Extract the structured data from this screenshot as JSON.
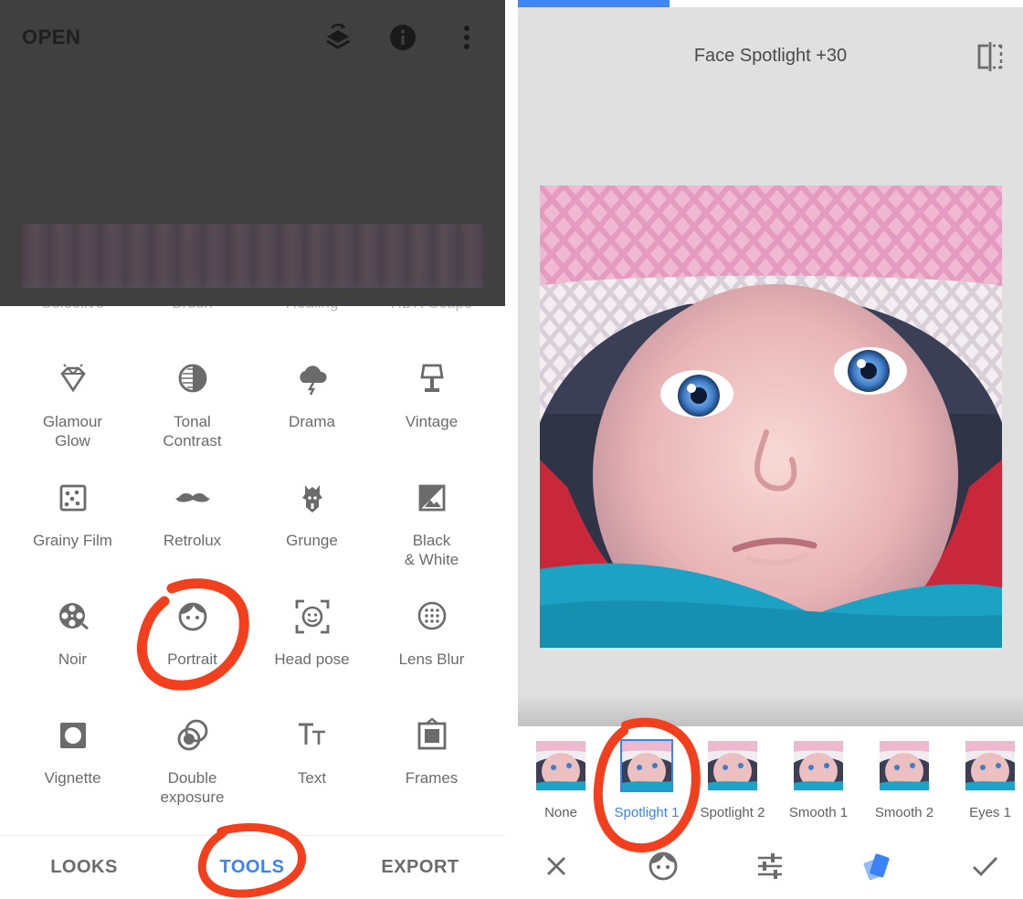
{
  "left_screen": {
    "top_bar": {
      "open_label": "OPEN",
      "icons": [
        "layers-stack-icon",
        "info-icon",
        "more-vert-icon"
      ]
    },
    "cut_off_row": [
      "Selective",
      "Brush",
      "Healing",
      "HDR Scape"
    ],
    "tools": [
      {
        "label": "Glamour\nGlow",
        "icon": "diamond-icon"
      },
      {
        "label": "Tonal\nContrast",
        "icon": "contrast-circle-icon"
      },
      {
        "label": "Drama",
        "icon": "storm-cloud-icon"
      },
      {
        "label": "Vintage",
        "icon": "lamp-icon"
      },
      {
        "label": "Grainy Film",
        "icon": "grain-icon"
      },
      {
        "label": "Retrolux",
        "icon": "mustache-icon"
      },
      {
        "label": "Grunge",
        "icon": "grunge-guitar-icon"
      },
      {
        "label": "Black\n& White",
        "icon": "bw-photo-icon"
      },
      {
        "label": "Noir",
        "icon": "film-reel-icon"
      },
      {
        "label": "Portrait",
        "icon": "face-icon"
      },
      {
        "label": "Head pose",
        "icon": "head-pose-icon"
      },
      {
        "label": "Lens Blur",
        "icon": "lens-blur-icon"
      },
      {
        "label": "Vignette",
        "icon": "vignette-icon"
      },
      {
        "label": "Double\nexposure",
        "icon": "double-exposure-icon"
      },
      {
        "label": "Text",
        "icon": "text-icon"
      },
      {
        "label": "Frames",
        "icon": "frame-icon"
      }
    ],
    "bottom_nav": {
      "looks": "LOOKS",
      "tools": "TOOLS",
      "export": "EXPORT",
      "active": "TOOLS"
    }
  },
  "right_screen": {
    "progress_fraction": 0.3,
    "title": "Face Spotlight +30",
    "compare_icon": "compare-split-icon",
    "presets": [
      {
        "label": "None",
        "active": false
      },
      {
        "label": "Spotlight 1",
        "active": true
      },
      {
        "label": "Spotlight 2",
        "active": false
      },
      {
        "label": "Smooth 1",
        "active": false
      },
      {
        "label": "Smooth 2",
        "active": false
      },
      {
        "label": "Eyes 1",
        "active": false
      }
    ],
    "action_bar_icons": [
      "close-icon",
      "face-icon",
      "sliders-icon",
      "styles-cards-icon",
      "check-icon"
    ]
  },
  "colors": {
    "accent": "#3b82f6",
    "annotation_red": "#f2401f",
    "dim_overlay": "#404040",
    "panel_gray": "#e0e0e0"
  }
}
